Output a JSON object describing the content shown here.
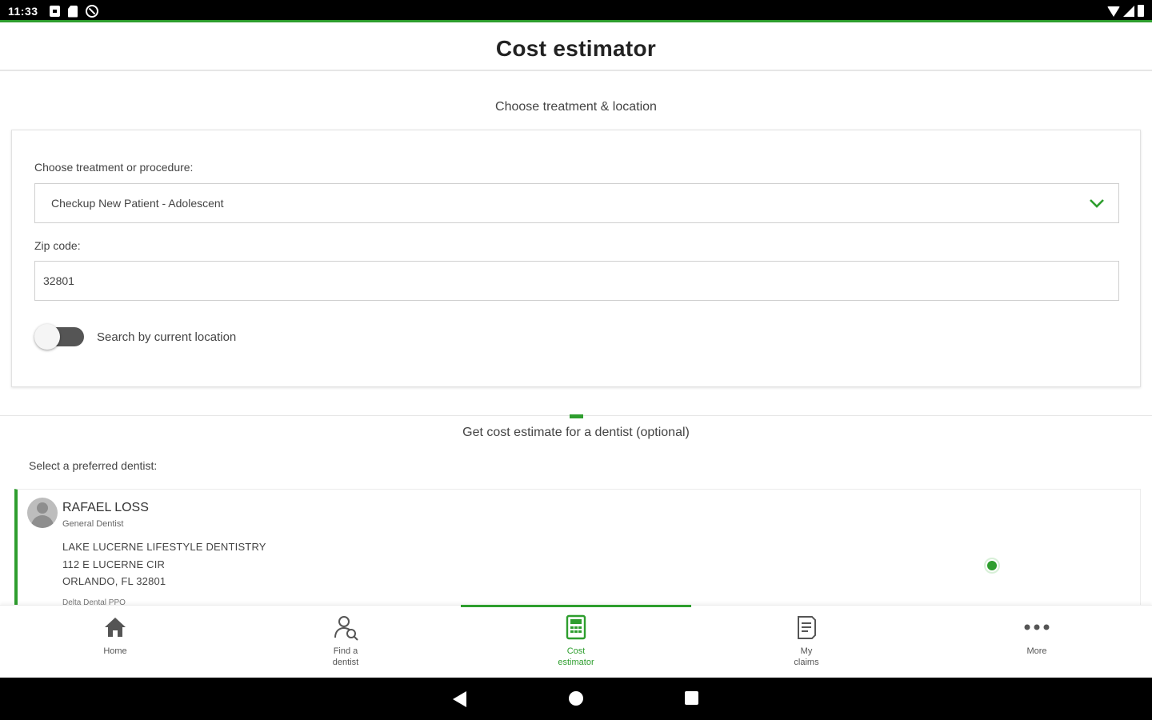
{
  "status_bar": {
    "time": "11:33"
  },
  "header": {
    "title": "Cost estimator"
  },
  "section1": {
    "title": "Choose treatment & location"
  },
  "treatment": {
    "label": "Choose treatment or procedure:",
    "selected": "Checkup New Patient - Adolescent"
  },
  "zip": {
    "label": "Zip code:",
    "value": "32801",
    "placeholder": ""
  },
  "location_toggle": {
    "label": "Search by current location",
    "on": false
  },
  "section2": {
    "title": "Get cost estimate for a dentist (optional)"
  },
  "preferred_label": "Select a preferred dentist:",
  "dentist": {
    "name": "RAFAEL LOSS",
    "type": "General Dentist",
    "practice": "LAKE LUCERNE LIFESTYLE DENTISTRY",
    "address1": "112 E LUCERNE CIR",
    "address2": "ORLANDO, FL 32801",
    "plan": "Delta Dental PPO",
    "selected": true
  },
  "nav": {
    "items": [
      {
        "label": "Home",
        "icon": "home-icon"
      },
      {
        "label": "Find a dentist",
        "icon": "find-dentist-icon"
      },
      {
        "label": "Cost estimator",
        "icon": "calculator-icon"
      },
      {
        "label": "My claims",
        "icon": "claims-icon"
      },
      {
        "label": "More",
        "icon": "more-icon"
      }
    ],
    "active_index": 2
  },
  "colors": {
    "accent": "#2e9e2e",
    "status_bar": "#000000",
    "text": "#333333"
  }
}
